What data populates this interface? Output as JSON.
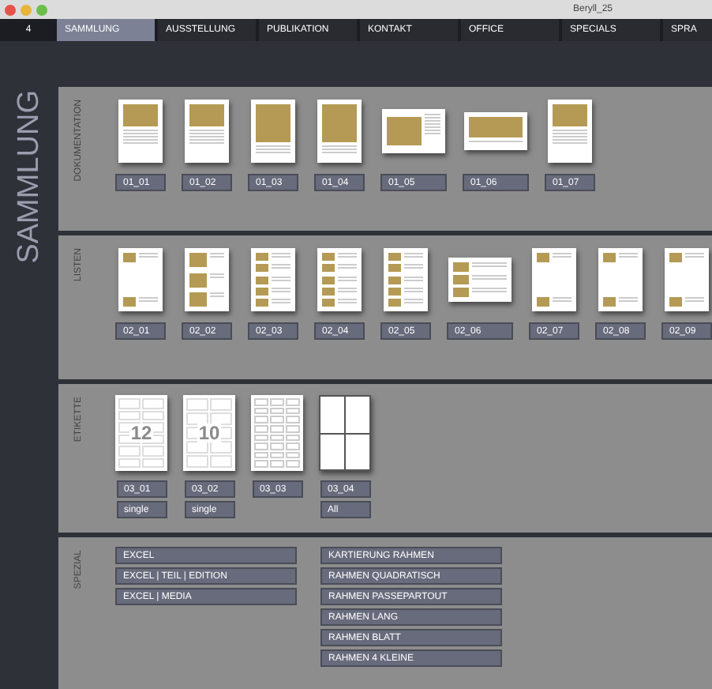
{
  "window": {
    "title": "Beryll_25"
  },
  "nav": {
    "counter": "4",
    "tabs": [
      {
        "label": "SAMMLUNG",
        "selected": true
      },
      {
        "label": "AUSSTELLUNG",
        "selected": false
      },
      {
        "label": "PUBLIKATION",
        "selected": false
      },
      {
        "label": "KONTAKT",
        "selected": false
      },
      {
        "label": "OFFICE",
        "selected": false
      },
      {
        "label": "SPECIALS",
        "selected": false
      },
      {
        "label": "SPRA",
        "selected": false
      }
    ]
  },
  "sidebar": {
    "title": "SAMMLUNG"
  },
  "sections": [
    {
      "label": "DOKUMENTATION",
      "items": [
        {
          "kind": "doc-top",
          "code": "01_01"
        },
        {
          "kind": "doc-top",
          "code": "01_02"
        },
        {
          "kind": "doc-full",
          "code": "01_03"
        },
        {
          "kind": "doc-full",
          "code": "01_04"
        },
        {
          "kind": "land-left",
          "code": "01_05"
        },
        {
          "kind": "land-wide",
          "code": "01_06"
        },
        {
          "kind": "doc-top",
          "code": "01_07"
        }
      ]
    },
    {
      "label": "LISTEN",
      "items": [
        {
          "kind": "list-2",
          "code": "02_01"
        },
        {
          "kind": "list-3",
          "code": "02_02"
        },
        {
          "kind": "list-5",
          "code": "02_03"
        },
        {
          "kind": "list-5",
          "code": "02_04"
        },
        {
          "kind": "list-5",
          "code": "02_05"
        },
        {
          "kind": "list-land",
          "code": "02_06"
        },
        {
          "kind": "list-2",
          "code": "02_07"
        },
        {
          "kind": "list-2",
          "code": "02_08"
        },
        {
          "kind": "list-2",
          "code": "02_09"
        }
      ]
    },
    {
      "label": "ETIKETTE",
      "items": [
        {
          "kind": "grid-6",
          "number": "12",
          "code": "03_01",
          "option": "single"
        },
        {
          "kind": "grid-5",
          "number": "10",
          "code": "03_02",
          "option": "single"
        },
        {
          "kind": "grid-dense",
          "code": "03_03"
        },
        {
          "kind": "grid-4",
          "code": "03_04",
          "option": "All"
        }
      ]
    }
  ],
  "special": {
    "label": "SPEZIAL",
    "columns": [
      [
        "EXCEL",
        "EXCEL | TEIL | EDITION",
        "EXCEL | MEDIA"
      ],
      [
        "KARTIERUNG RAHMEN",
        "RAHMEN QUADRATISCH",
        "RAHMEN PASSEPARTOUT",
        "RAHMEN LANG",
        "RAHMEN BLATT",
        "RAHMEN 4 KLEINE"
      ]
    ]
  }
}
